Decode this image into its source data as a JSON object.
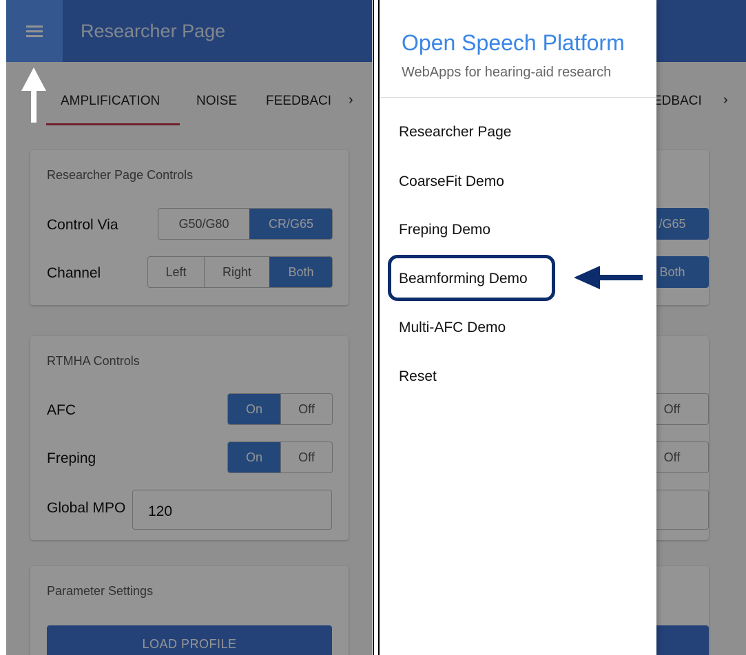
{
  "app": {
    "title": "Researcher Page",
    "tabs": [
      "AMPLIFICATION",
      "NOISE",
      "FEEDBACI"
    ],
    "tabs_scroll_icon": "chevron-right-icon",
    "researcher_controls": {
      "title": "Researcher Page Controls",
      "control_via_label": "Control Via",
      "control_via_options": [
        "G50/G80",
        "CR/G65"
      ],
      "control_via_selected": "CR/G65",
      "channel_label": "Channel",
      "channel_options": [
        "Left",
        "Right",
        "Both"
      ],
      "channel_selected": "Both"
    },
    "rtmha_controls": {
      "title": "RTMHA Controls",
      "afc_label": "AFC",
      "afc_on": "On",
      "afc_off": "Off",
      "freping_label": "Freping",
      "freping_on": "On",
      "freping_off": "Off",
      "global_mpo_label": "Global MPO",
      "global_mpo_value": "120"
    },
    "parameter_settings": {
      "title": "Parameter Settings",
      "load_profile": "LOAD PROFILE"
    }
  },
  "right_app": {
    "tab_fragment": "EDBACI",
    "control_via_fragment": "/G65",
    "channel_fragment": "Both",
    "afc_fragment": "Off",
    "freping_fragment": "Off"
  },
  "drawer": {
    "title": "Open Speech Platform",
    "subtitle": "WebApps for hearing-aid research",
    "items": [
      "Researcher Page",
      "CoarseFit Demo",
      "Freping Demo",
      "Beamforming Demo",
      "Multi-AFC Demo",
      "Reset"
    ],
    "highlighted_item": "Beamforming Demo"
  },
  "colors": {
    "appbar": "#3f72cf",
    "menu_button": "#5b97f7",
    "selected_segment": "#3f7bd3",
    "tab_indicator": "#c4354f",
    "drawer_title": "#3a86e6",
    "annotation": "#0c2c6b"
  }
}
